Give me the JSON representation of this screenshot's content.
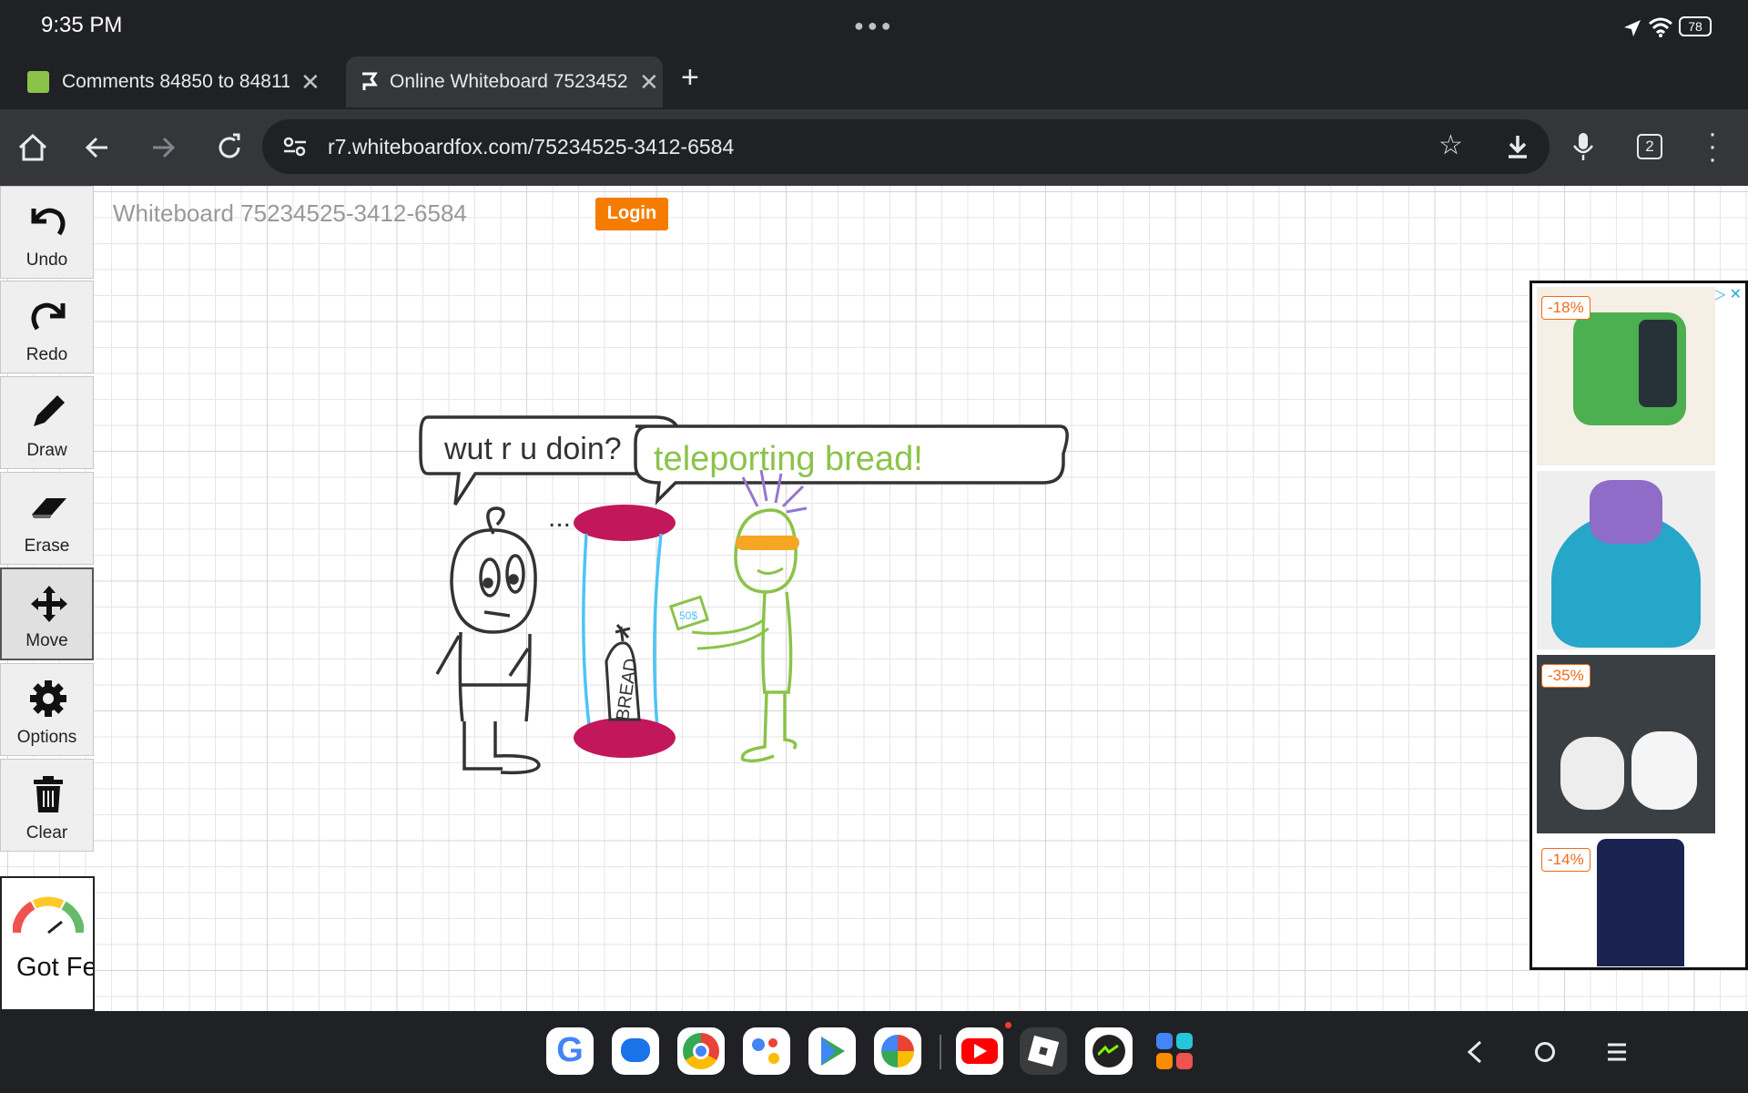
{
  "status": {
    "time": "9:35 PM",
    "battery": "78"
  },
  "tabs": [
    {
      "title": "Comments 84850 to 84811",
      "active": false
    },
    {
      "title": "Online Whiteboard 7523452",
      "active": true
    }
  ],
  "address": {
    "url": "r7.whiteboardfox.com/75234525-3412-6584",
    "tab_count": "2"
  },
  "page": {
    "title": "Whiteboard 75234525-3412-6584",
    "login_label": "Login"
  },
  "tools": [
    {
      "label": "Undo",
      "icon": "undo-icon"
    },
    {
      "label": "Redo",
      "icon": "redo-icon"
    },
    {
      "label": "Draw",
      "icon": "pencil-icon"
    },
    {
      "label": "Erase",
      "icon": "eraser-icon"
    },
    {
      "label": "Move",
      "icon": "move-icon"
    },
    {
      "label": "Options",
      "icon": "gear-icon"
    },
    {
      "label": "Clear",
      "icon": "trash-icon"
    }
  ],
  "feedback": {
    "label": "Got Feedb"
  },
  "drawing": {
    "bubble_left": "wut r u doin?",
    "bubble_right": "teleporting bread!",
    "dots": "...",
    "bread_label": "BREAD",
    "card_label": "50$"
  },
  "ad": {
    "badges": [
      "-18%",
      "-35%",
      "-14%"
    ]
  },
  "colors": {
    "login": "#f57c00",
    "magenta": "#c2185b",
    "green": "#8bc34a",
    "cyan": "#4fc3f7",
    "orange": "#f5a623",
    "purple": "#9575cd"
  }
}
